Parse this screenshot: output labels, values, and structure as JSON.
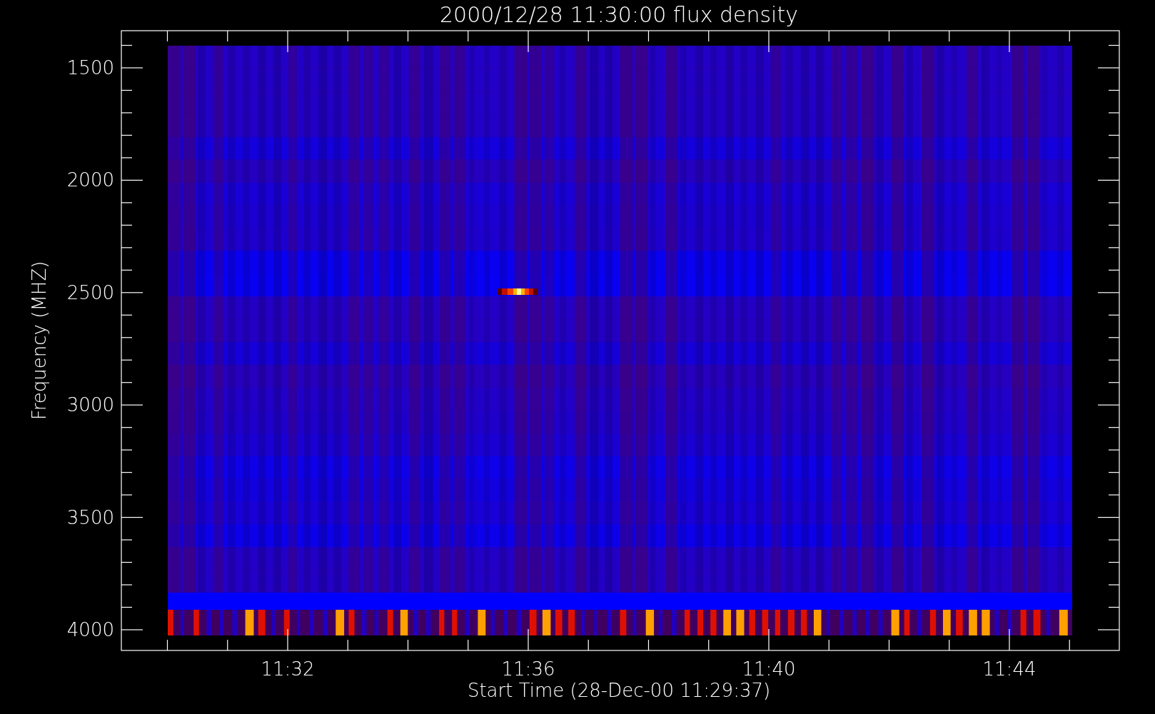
{
  "plot": {
    "title": "2000/12/28 11:30:00 flux density",
    "x_axis": {
      "label": "Start Time (28-Dec-00 11:29:37)",
      "tick_labels": [
        "11:32",
        "11:36",
        "11:40",
        "11:44"
      ]
    },
    "y_axis": {
      "label": "Frequency (MHZ)",
      "tick_labels": [
        "1500",
        "2000",
        "2500",
        "3000",
        "3500",
        "4000"
      ]
    }
  }
}
